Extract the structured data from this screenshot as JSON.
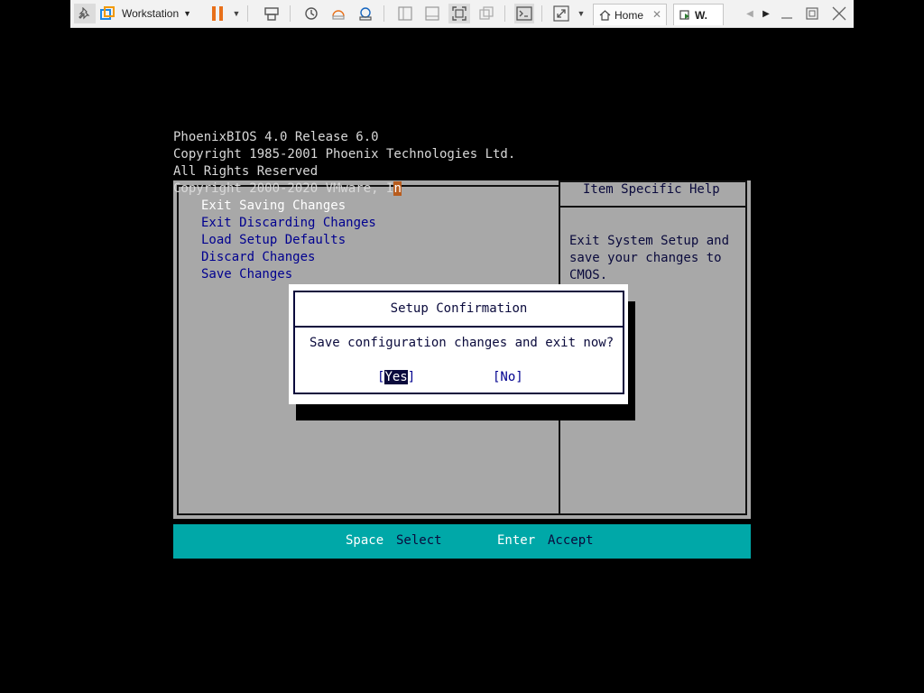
{
  "toolbar": {
    "product_label": "Workstation",
    "tabs": [
      {
        "label": "Home"
      },
      {
        "label": "W."
      }
    ],
    "colors": {
      "pause": "#e8701a",
      "accent": "#1e88e5"
    }
  },
  "bios": {
    "header_lines": [
      "PhoenixBIOS 4.0 Release 6.0",
      "Copyright 1985-2001 Phoenix Technologies Ltd.",
      "All Rights Reserved",
      "Copyright 2000-2020 VMware, I"
    ],
    "header_cursor_char": "n",
    "menu_items": [
      {
        "label": "Exit Saving Changes",
        "selected": true
      },
      {
        "label": "Exit Discarding Changes"
      },
      {
        "label": "Load Setup Defaults"
      },
      {
        "label": "Discard Changes"
      },
      {
        "label": "Save Changes"
      }
    ],
    "help": {
      "title": "Item Specific Help",
      "text": "Exit System Setup and\nsave your changes to\nCMOS."
    },
    "dialog": {
      "title": "Setup Confirmation",
      "message": "Save configuration changes and exit now?",
      "yes_open": "[",
      "yes_label": "Yes",
      "yes_close": "]",
      "no_label": "[No]"
    },
    "status_bar": [
      {
        "key": "Space",
        "action": "Select"
      },
      {
        "key": "Enter",
        "action": "Accept"
      }
    ],
    "colors": {
      "panel": "#a8a8a8",
      "status_bar": "#00a8a8",
      "menu_text": "#00008f"
    }
  }
}
